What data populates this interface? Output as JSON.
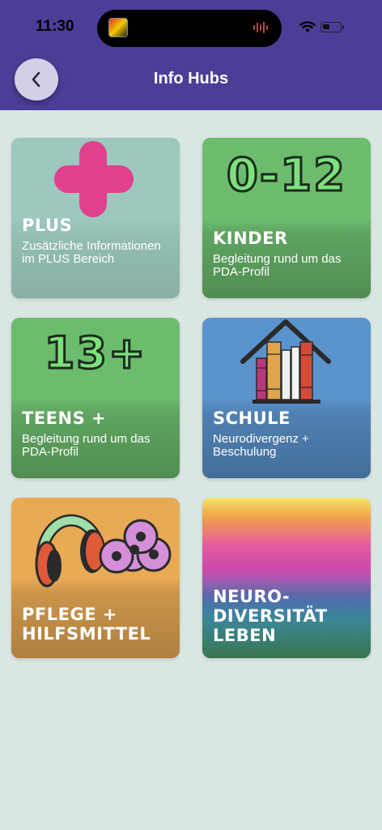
{
  "status_bar": {
    "time": "11:30"
  },
  "header": {
    "title": "Info Hubs",
    "back_icon": "chevron-left-icon"
  },
  "colors": {
    "header_bg": "#4c3e97",
    "page_bg": "#dae6e2"
  },
  "cards": [
    {
      "title": "PLUS",
      "subtitle": "Zusätzliche Informationen im PLUS Bereich",
      "bg": "#9cc8bd",
      "icon": "plus-icon"
    },
    {
      "title": "KINDER",
      "subtitle": "Begleitung rund um das PDA-Profil",
      "bg": "#6cbc6e",
      "icon": "age-0-12-icon",
      "badge": "0-12"
    },
    {
      "title": "TEENS +",
      "subtitle": "Begleitung rund um das PDA-Profil",
      "bg": "#6cbc6e",
      "icon": "age-13-plus-icon",
      "badge": "13+"
    },
    {
      "title": "SCHULE",
      "subtitle": "Neurodivergenz + Beschulung",
      "bg": "#5b93cc",
      "icon": "books-house-icon"
    },
    {
      "title": "PFLEGE + HILFSMITTEL",
      "title_lines": [
        "PFLEGE +",
        "HILFSMITTEL"
      ],
      "subtitle": "",
      "bg": "#e8aa55",
      "icon": "headphones-fidget-spinner-icon"
    },
    {
      "title": "NEURO-DIVERSITÄT LEBEN",
      "title_lines": [
        "NEURO-",
        "DIVERSITÄT",
        "LEBEN"
      ],
      "subtitle": "",
      "bg": "rainbow-gradient",
      "icon": ""
    }
  ]
}
